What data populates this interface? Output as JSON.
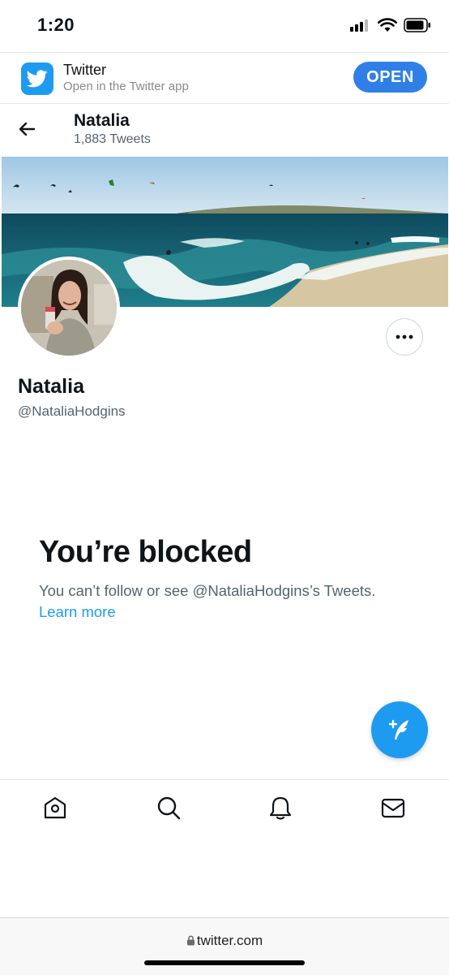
{
  "status_bar": {
    "time": "1:20"
  },
  "app_banner": {
    "app_name": "Twitter",
    "subtitle": "Open in the Twitter app",
    "open_label": "OPEN"
  },
  "header": {
    "name": "Natalia",
    "tweet_count": "1,883 Tweets"
  },
  "profile": {
    "display_name": "Natalia",
    "handle": "@NataliaHodgins"
  },
  "blocked": {
    "title": "You’re blocked",
    "message": "You can’t follow or see @NataliaHodgins’s Tweets.",
    "learn_more": "Learn more"
  },
  "browser": {
    "url": "twitter.com"
  },
  "colors": {
    "accent": "#1d9bf0",
    "open_button": "#2f7fe6",
    "secondary_text": "#536471"
  },
  "icons": {
    "nav": [
      "home-icon",
      "search-icon",
      "notifications-icon",
      "messages-icon"
    ],
    "misc": [
      "back-arrow-icon",
      "more-options-icon",
      "compose-tweet-icon",
      "lock-icon",
      "twitter-bird-icon"
    ]
  }
}
